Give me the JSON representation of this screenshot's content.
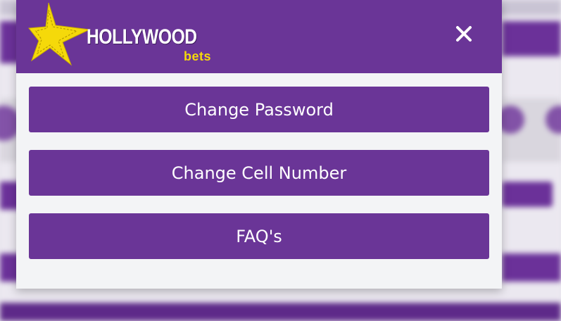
{
  "brand": {
    "name": "HOLLYWOOD",
    "sub": "bets",
    "icon": "star-logo-icon"
  },
  "header": {
    "close_icon": "close-icon"
  },
  "menu": {
    "items": [
      {
        "label": "Change Password"
      },
      {
        "label": "Change Cell Number"
      },
      {
        "label": "FAQ's"
      }
    ]
  },
  "colors": {
    "brand_purple": "#6a3597",
    "logo_yellow": "#f5d90a",
    "panel_bg": "#f3f4f6"
  }
}
